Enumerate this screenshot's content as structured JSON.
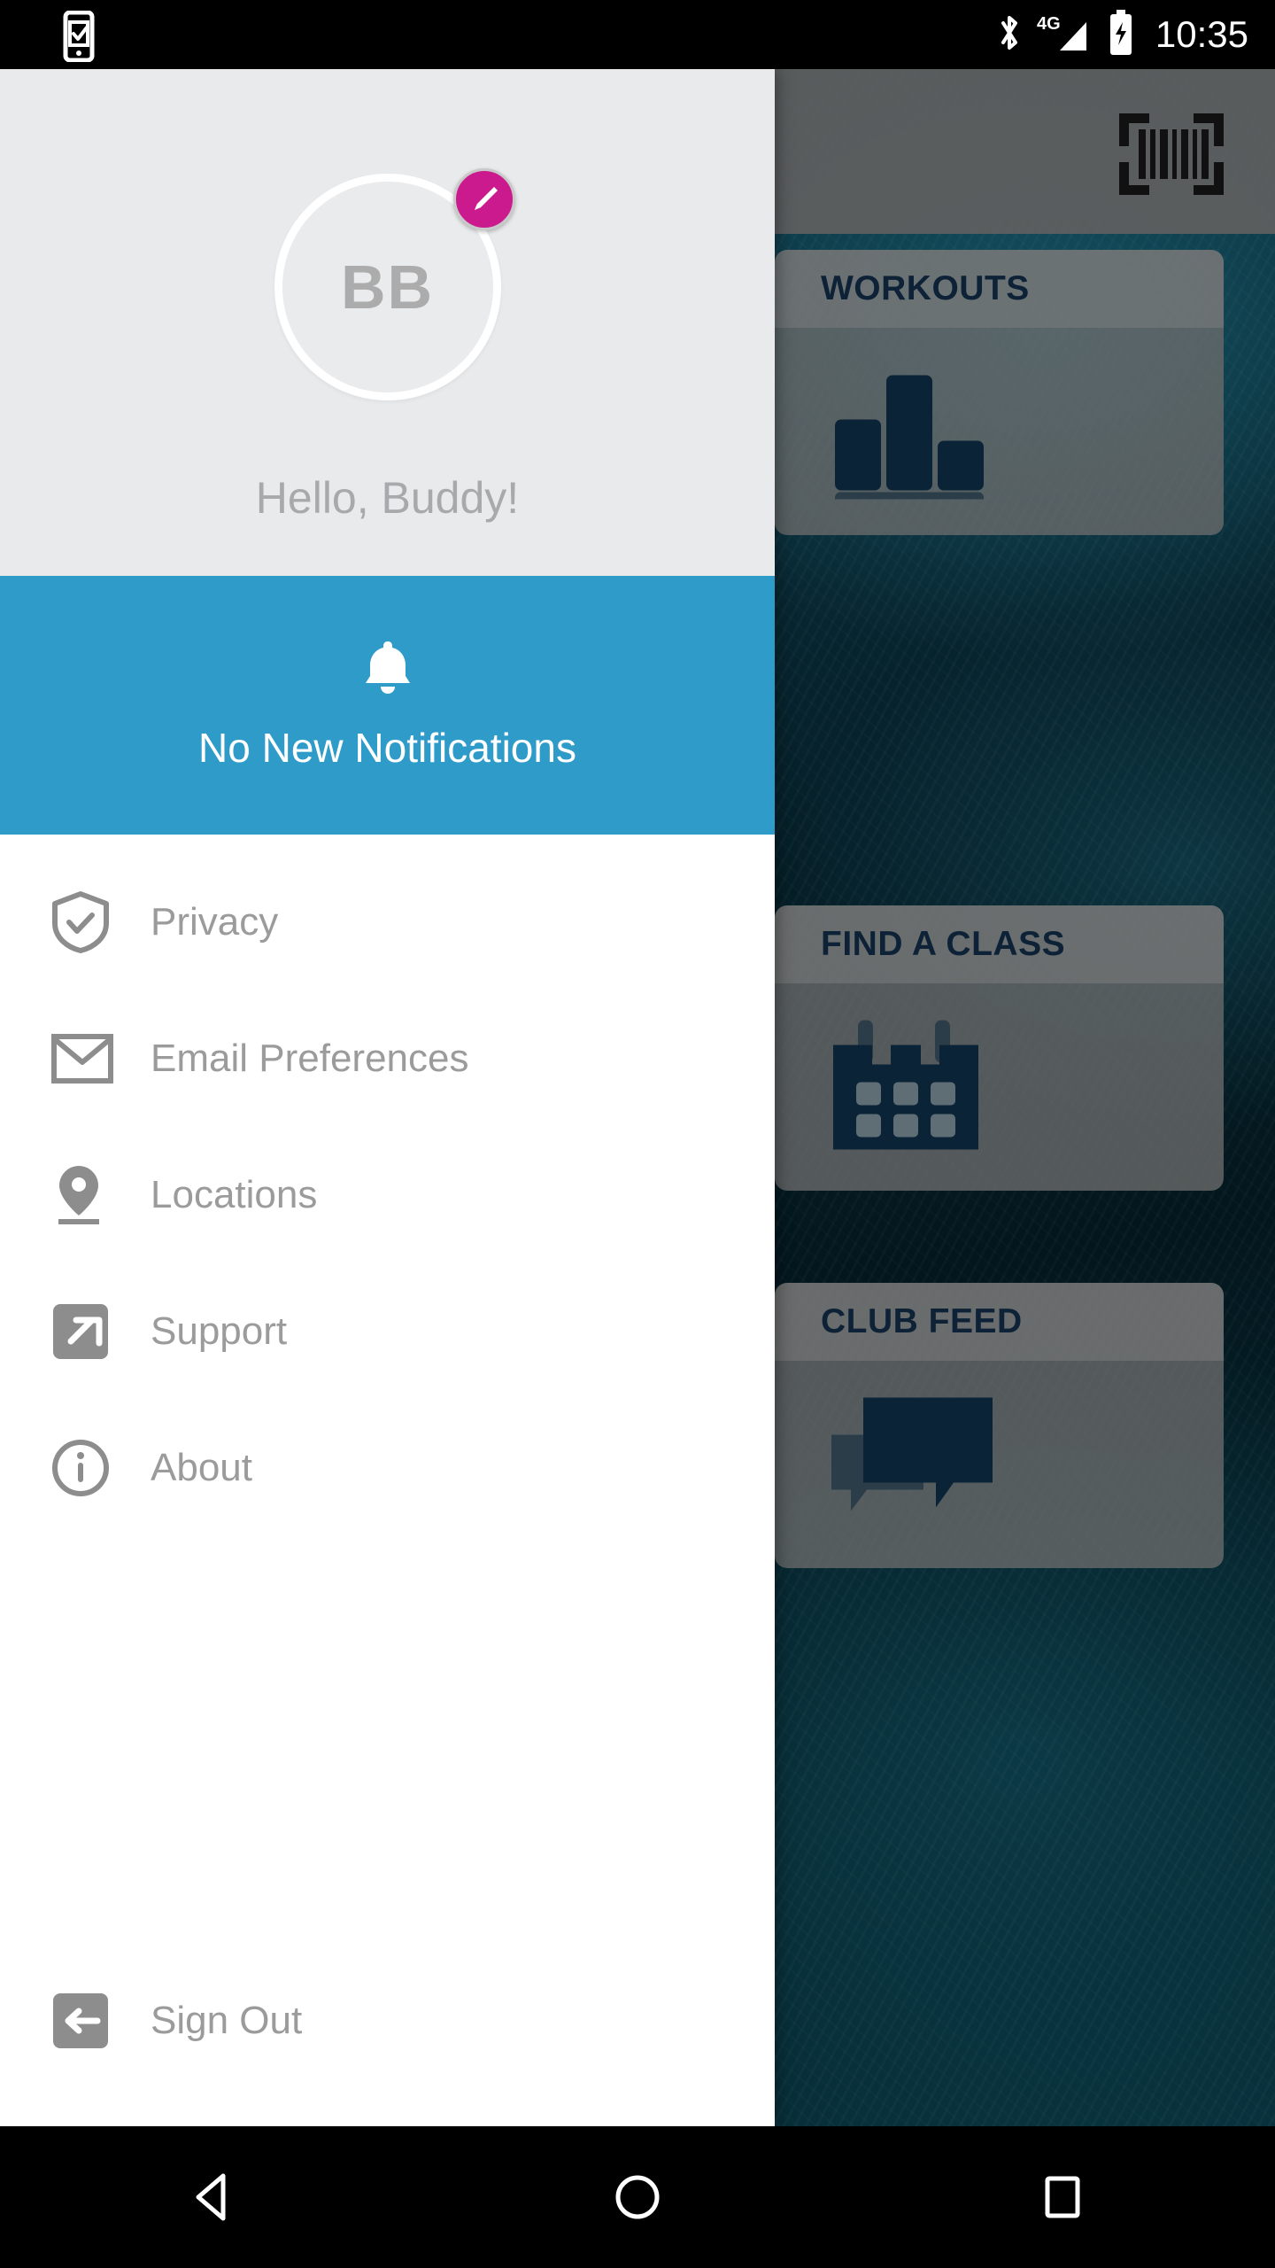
{
  "status_bar": {
    "time": "10:35",
    "icons": [
      "phone-check-icon",
      "bluetooth-icon",
      "signal-4g-icon",
      "battery-charging-icon"
    ],
    "network_label": "4G"
  },
  "app_bar": {
    "scan_icon": "barcode-scan-icon"
  },
  "background_cards": [
    {
      "title": "WORKOUTS",
      "icon": "bar-chart-icon"
    },
    {
      "title": "FIND A CLASS",
      "icon": "calendar-icon"
    },
    {
      "title": "CLUB FEED",
      "icon": "chat-bubbles-icon"
    }
  ],
  "drawer": {
    "avatar": {
      "initials": "BB",
      "edit_icon": "pencil-icon"
    },
    "greeting": "Hello, Buddy!",
    "notification": {
      "icon": "bell-icon",
      "label": "No New Notifications"
    },
    "menu": [
      {
        "label": "Privacy",
        "icon": "shield-check-icon"
      },
      {
        "label": "Email Preferences",
        "icon": "envelope-icon"
      },
      {
        "label": "Locations",
        "icon": "map-pin-icon"
      },
      {
        "label": "Support",
        "icon": "external-link-icon"
      },
      {
        "label": "About",
        "icon": "info-circle-icon"
      }
    ],
    "sign_out": {
      "label": "Sign Out",
      "icon": "logout-arrow-icon"
    }
  },
  "nav_bar": {
    "back": "back-triangle-icon",
    "home": "home-circle-icon",
    "recents": "recents-square-icon"
  },
  "colors": {
    "accent_blue": "#2f9bc9",
    "accent_magenta": "#cb1a8d",
    "card_title_navy": "#0d2236",
    "drawer_header_bg": "#e8eaec",
    "menu_text_gray": "#9b9b9b"
  }
}
